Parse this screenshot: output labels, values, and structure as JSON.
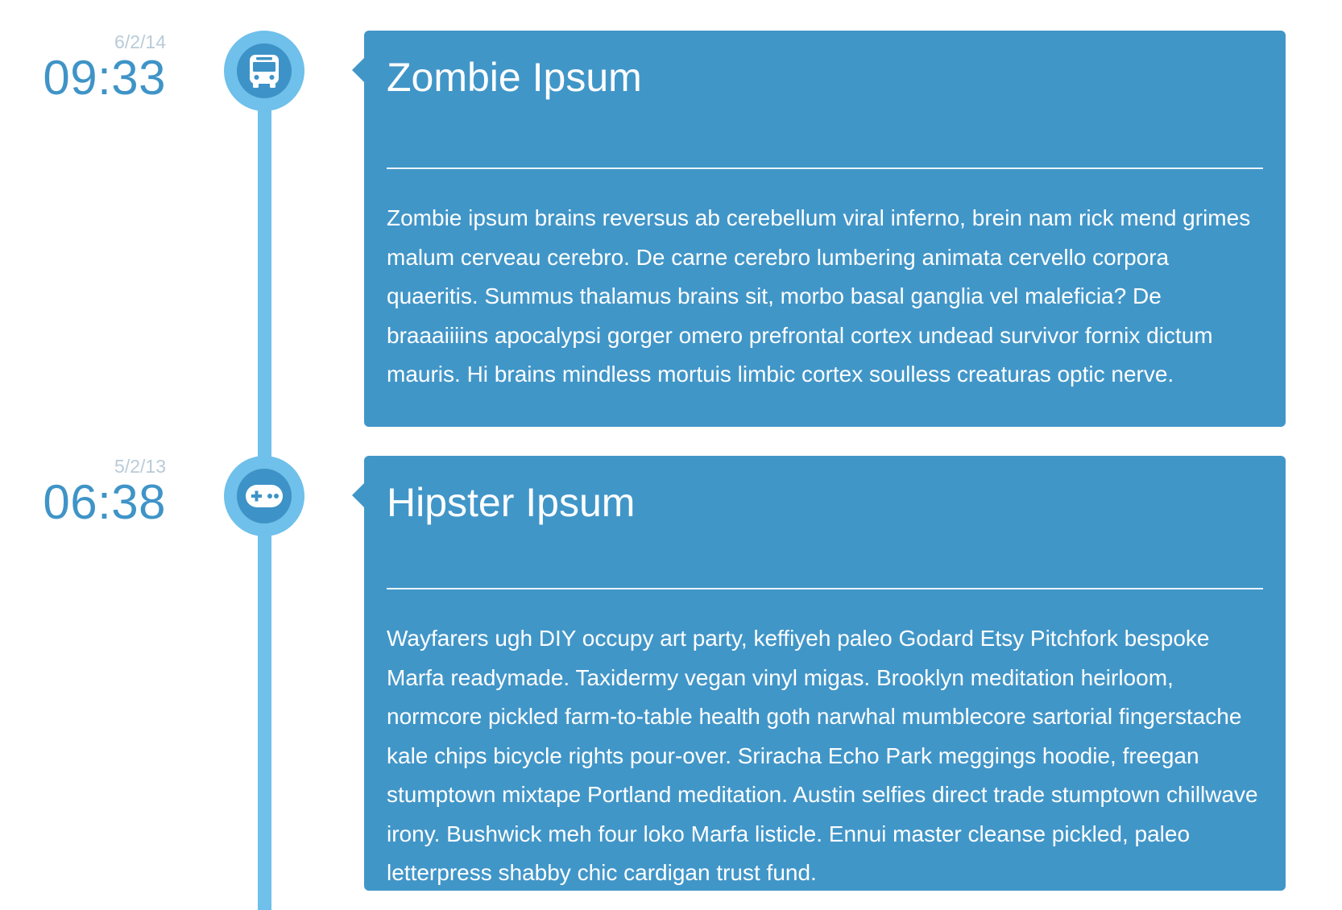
{
  "entries": [
    {
      "date": "6/2/14",
      "time": "09:33",
      "icon": "bus-icon",
      "title": "Zombie Ipsum",
      "body": "Zombie ipsum brains reversus ab cerebellum viral inferno, brein nam rick mend grimes malum cerveau cerebro. De carne cerebro lumbering animata cervello corpora quaeritis. Summus thalamus brains sit, morbo basal ganglia vel maleficia? De braaaiiiins apocalypsi gorger omero prefrontal cortex undead survivor fornix dictum mauris. Hi brains mindless mortuis limbic cortex soulless creaturas optic nerve."
    },
    {
      "date": "5/2/13",
      "time": "06:38",
      "icon": "gamepad-icon",
      "title": "Hipster Ipsum",
      "body": "Wayfarers ugh DIY occupy art party, keffiyeh paleo Godard Etsy Pitchfork bespoke Marfa readymade. Taxidermy vegan vinyl migas. Brooklyn meditation heirloom, normcore pickled farm-to-table health goth narwhal mumblecore sartorial fingerstache kale chips bicycle rights pour-over. Sriracha Echo Park meggings hoodie, freegan stumptown mixtape Portland meditation. Austin selfies direct trade stumptown chillwave irony. Bushwick meh four loko Marfa listicle. Ennui master cleanse pickled, paleo letterpress shabby chic cardigan trust fund."
    }
  ],
  "colors": {
    "card": "#4196c8",
    "line": "#6fc0ea",
    "time": "#3f94c7",
    "date": "#b9cbd8"
  }
}
